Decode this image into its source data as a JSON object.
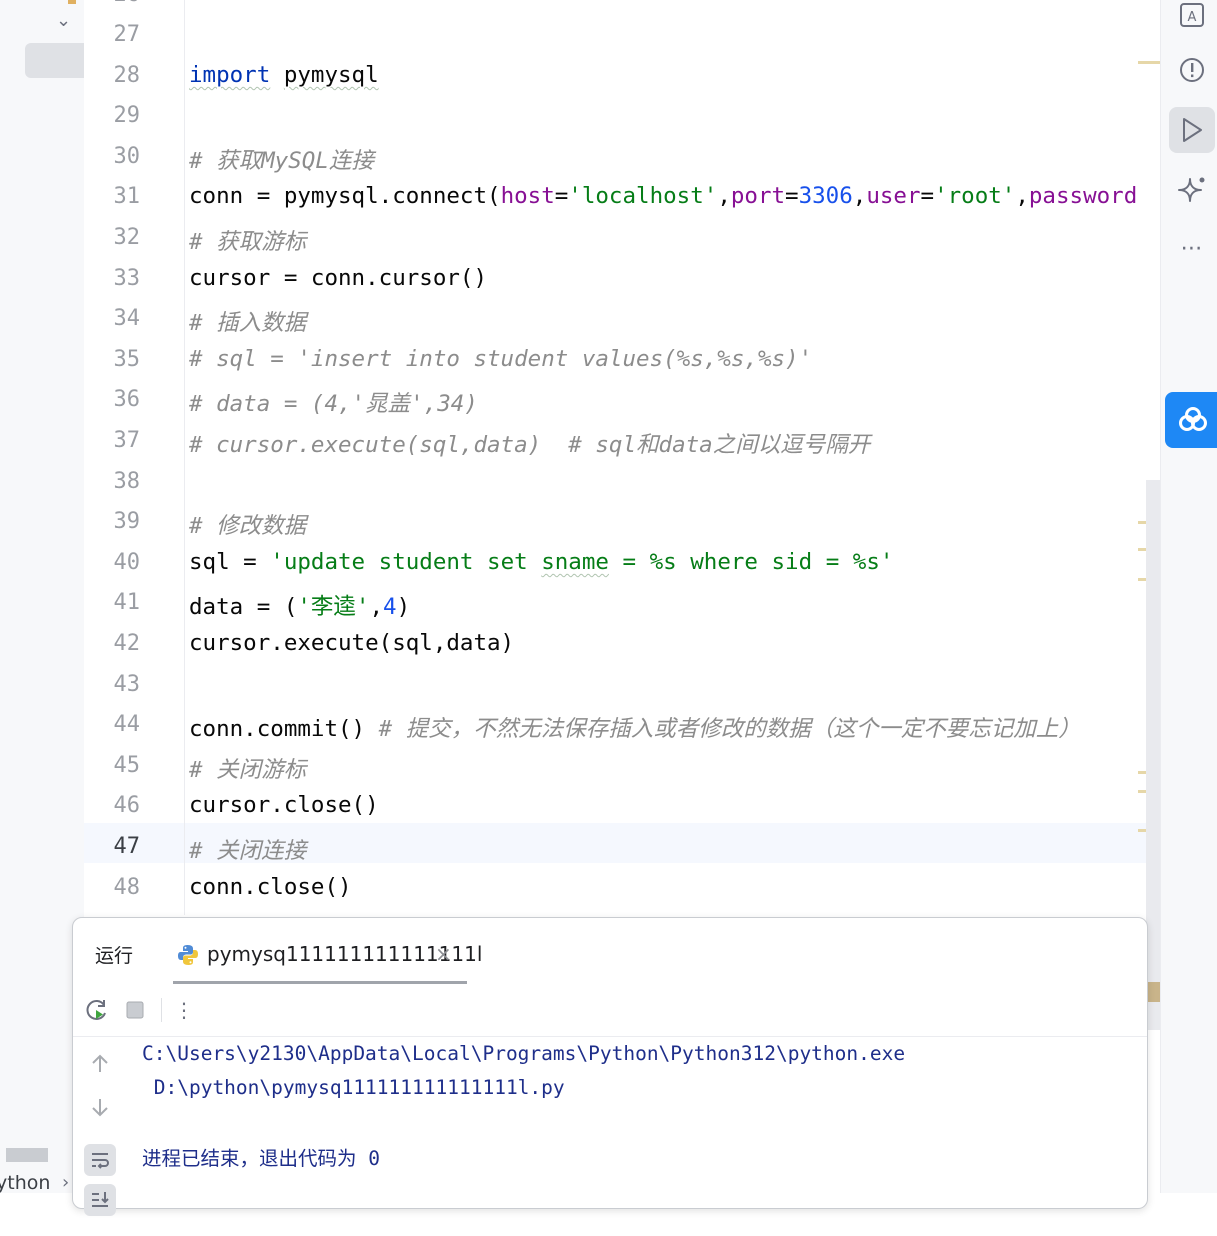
{
  "editor": {
    "partial_top_line_number": "26",
    "lines": [
      {
        "n": "27",
        "segments": []
      },
      {
        "n": "28",
        "segments": [
          {
            "t": "import",
            "c": "kw squig"
          },
          {
            "t": " ",
            "c": ""
          },
          {
            "t": "pymysql",
            "c": "squig"
          }
        ]
      },
      {
        "n": "29",
        "segments": []
      },
      {
        "n": "30",
        "segments": [
          {
            "t": "# 获取MySQL连接",
            "c": "cmt"
          }
        ]
      },
      {
        "n": "31",
        "segments": [
          {
            "t": "conn = pymysql.connect(",
            "c": ""
          },
          {
            "t": "host",
            "c": "param"
          },
          {
            "t": "=",
            "c": ""
          },
          {
            "t": "'localhost'",
            "c": "str"
          },
          {
            "t": ",",
            "c": ""
          },
          {
            "t": "port",
            "c": "param"
          },
          {
            "t": "=",
            "c": ""
          },
          {
            "t": "3306",
            "c": "num"
          },
          {
            "t": ",",
            "c": ""
          },
          {
            "t": "user",
            "c": "param"
          },
          {
            "t": "=",
            "c": ""
          },
          {
            "t": "'root'",
            "c": "str"
          },
          {
            "t": ",",
            "c": ""
          },
          {
            "t": "password",
            "c": "param"
          }
        ]
      },
      {
        "n": "32",
        "segments": [
          {
            "t": "# 获取游标",
            "c": "cmt"
          }
        ]
      },
      {
        "n": "33",
        "segments": [
          {
            "t": "cursor = conn.cursor()",
            "c": ""
          }
        ]
      },
      {
        "n": "34",
        "segments": [
          {
            "t": "# 插入数据",
            "c": "cmt"
          }
        ]
      },
      {
        "n": "35",
        "segments": [
          {
            "t": "# sql = 'insert into student values(%s,%s,%s)'",
            "c": "cmt"
          }
        ]
      },
      {
        "n": "36",
        "segments": [
          {
            "t": "# data = (4,'晁盖',34)",
            "c": "cmt"
          }
        ]
      },
      {
        "n": "37",
        "segments": [
          {
            "t": "# cursor.execute(sql,data)  # sql和data之间以逗号隔开",
            "c": "cmt"
          }
        ]
      },
      {
        "n": "38",
        "segments": []
      },
      {
        "n": "39",
        "segments": [
          {
            "t": "# 修改数据",
            "c": "cmt"
          }
        ]
      },
      {
        "n": "40",
        "segments": [
          {
            "t": "sql = ",
            "c": ""
          },
          {
            "t": "'update student set ",
            "c": "str"
          },
          {
            "t": "sname",
            "c": "str squig"
          },
          {
            "t": " = %s where sid = %s'",
            "c": "str"
          }
        ]
      },
      {
        "n": "41",
        "segments": [
          {
            "t": "data = (",
            "c": ""
          },
          {
            "t": "'李逵'",
            "c": "str"
          },
          {
            "t": ",",
            "c": ""
          },
          {
            "t": "4",
            "c": "num"
          },
          {
            "t": ")",
            "c": ""
          }
        ]
      },
      {
        "n": "42",
        "segments": [
          {
            "t": "cursor.execute(sql,data)",
            "c": ""
          }
        ]
      },
      {
        "n": "43",
        "segments": []
      },
      {
        "n": "44",
        "segments": [
          {
            "t": "conn.commit() ",
            "c": ""
          },
          {
            "t": "# 提交，不然无法保存插入或者修改的数据（这个一定不要忘记加上）",
            "c": "cmt"
          }
        ]
      },
      {
        "n": "45",
        "segments": [
          {
            "t": "# 关闭游标",
            "c": "cmt"
          }
        ]
      },
      {
        "n": "46",
        "segments": [
          {
            "t": "cursor.close()",
            "c": ""
          }
        ]
      },
      {
        "n": "47",
        "segments": [
          {
            "t": "# 关闭连接",
            "c": "cmt"
          }
        ]
      },
      {
        "n": "48",
        "segments": [
          {
            "t": "conn.close()",
            "c": ""
          }
        ]
      }
    ],
    "current_line": "47"
  },
  "right_toolbar": {
    "icons": [
      "translate-icon",
      "problems-icon",
      "run-icon",
      "ai-assistant-icon",
      "more-icon",
      "baidu-netdisk-icon"
    ],
    "more_label": "⋯"
  },
  "run_panel": {
    "title": "运行",
    "tab_label": "pymysq111111111111111l",
    "tab_close": "×",
    "toolbar_more": "⋮",
    "console": {
      "line1": "C:\\Users\\y2130\\AppData\\Local\\Programs\\Python\\Python312\\python.exe",
      "line2": " D:\\python\\pymysq111111111111111l.py",
      "line3": "进程已结束，退出代码为 0"
    }
  },
  "left_panel": {
    "path_fragment": "ython",
    "path_separator": "›"
  },
  "colors": {
    "keyword": "#0033b3",
    "string": "#067d17",
    "number": "#1750eb",
    "param": "#871094",
    "comment": "#8c8c8c",
    "console_text": "#1e2e8a",
    "accent_blue": "#1e88f5"
  }
}
